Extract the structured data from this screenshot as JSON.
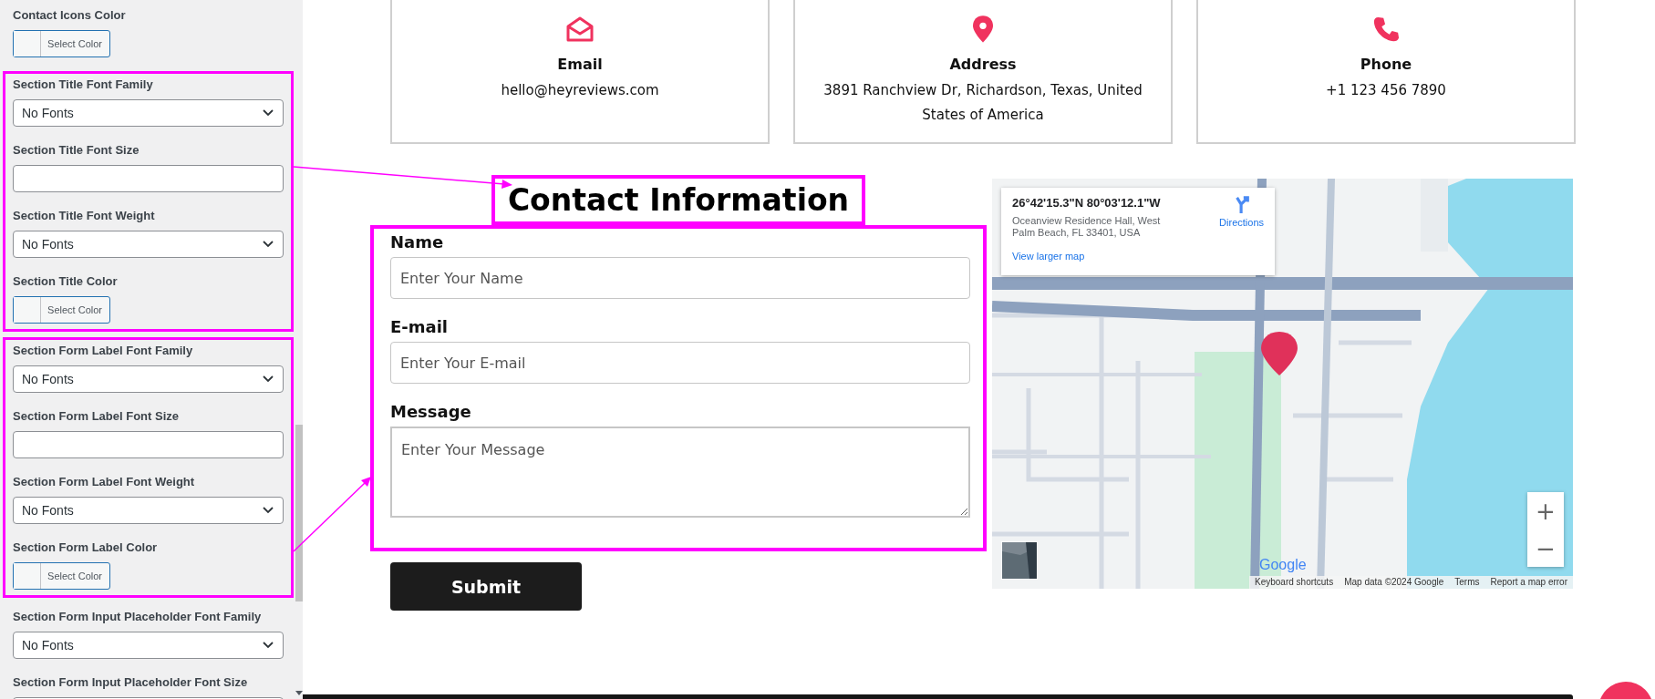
{
  "settings_panel": {
    "groups": [
      {
        "highlighted": false,
        "fields": [
          {
            "kind": "color",
            "label": "Contact Icons Color",
            "button": "Select Color"
          }
        ]
      },
      {
        "highlighted": true,
        "fields": [
          {
            "kind": "select",
            "label": "Section Title Font Family",
            "value": "No Fonts"
          },
          {
            "kind": "text",
            "label": "Section Title Font Size"
          },
          {
            "kind": "select",
            "label": "Section Title Font Weight",
            "value": "No Fonts"
          },
          {
            "kind": "color",
            "label": "Section Title Color",
            "button": "Select Color"
          }
        ]
      },
      {
        "highlighted": true,
        "fields": [
          {
            "kind": "select",
            "label": "Section Form Label Font Family",
            "value": "No Fonts"
          },
          {
            "kind": "text",
            "label": "Section Form Label Font Size"
          },
          {
            "kind": "select",
            "label": "Section Form Label Font Weight",
            "value": "No Fonts"
          },
          {
            "kind": "color",
            "label": "Section Form Label Color",
            "button": "Select Color"
          }
        ]
      },
      {
        "highlighted": false,
        "fields": [
          {
            "kind": "select",
            "label": "Section Form Input Placeholder Font Family",
            "value": "No Fonts"
          },
          {
            "kind": "text",
            "label": "Section Form Input Placeholder Font Size"
          }
        ]
      }
    ]
  },
  "contact_cards": [
    {
      "kind": "envelope",
      "title": "Email",
      "text": "hello@heyreviews.com"
    },
    {
      "kind": "pin",
      "title": "Address",
      "text": "3891 Ranchview Dr, Richardson, Texas, United States of America"
    },
    {
      "kind": "phone",
      "title": "Phone",
      "text": "+1 123 456 7890"
    }
  ],
  "contact_form": {
    "title": "Contact Information",
    "title_highlighted": true,
    "form_highlighted": true,
    "fields": [
      {
        "kind": "input",
        "label": "Name",
        "placeholder": "Enter Your Name"
      },
      {
        "kind": "input",
        "label": "E-mail",
        "placeholder": "Enter Your E-mail"
      },
      {
        "kind": "textarea",
        "label": "Message",
        "placeholder": "Enter Your Message"
      }
    ],
    "submit": "Submit"
  },
  "map": {
    "kind": "picture",
    "info_card": {
      "coordinates": "26°42'15.3\"N 80°03'12.1\"W",
      "address": "Oceanview Residence Hall, West Palm Beach, FL 33401, USA",
      "directions": "Directions",
      "link": "View larger map"
    },
    "zoom_in": "+",
    "zoom_out": "−",
    "logo": "Google",
    "attribution": [
      "Keyboard shortcuts",
      "Map data ©2024 Google",
      "Terms",
      "Report a map error"
    ]
  }
}
